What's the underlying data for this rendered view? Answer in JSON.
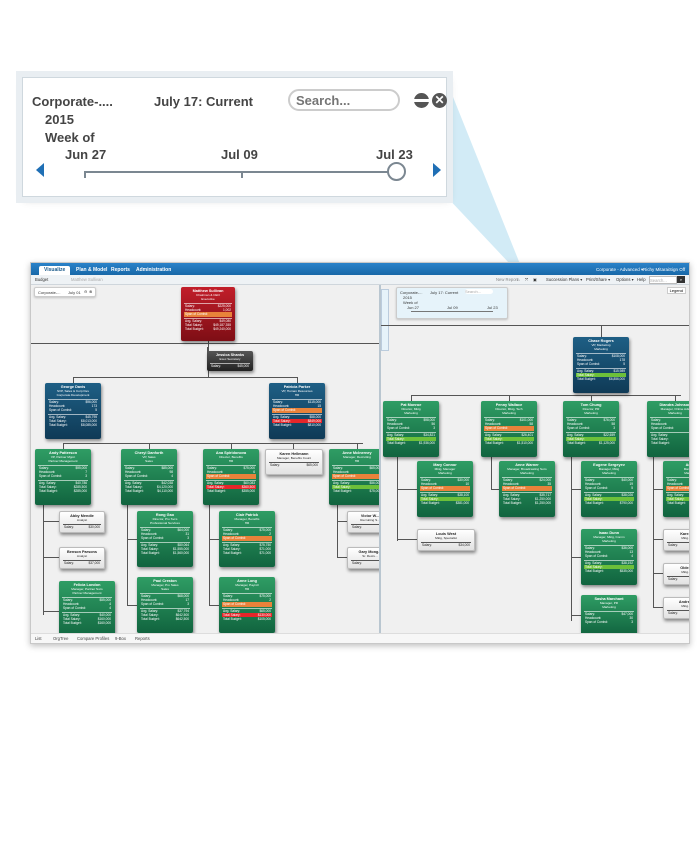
{
  "callout": {
    "title": "Corporate-....",
    "year": "2015",
    "week_of": "Week of",
    "current_label": "July 17: Current",
    "search_placeholder": "Search...",
    "timeline": {
      "ticks": [
        "Jun 27",
        "Jul 09",
        "Jul 23"
      ],
      "selected_index": 2,
      "prev_icon": "arrow-left-icon",
      "next_icon": "arrow-right-icon"
    },
    "collapse_icon": "minus-circle-icon",
    "close_icon": "close-circle-icon"
  },
  "app": {
    "tabs": [
      {
        "label": "Visualize",
        "active": true
      },
      {
        "label": "Plan & Model",
        "active": false
      },
      {
        "label": "Reports",
        "active": false
      },
      {
        "label": "Administration",
        "active": false
      }
    ],
    "top_right": {
      "org": "Corporate - Advanced ▾",
      "user": "Richy Mitarai",
      "sign_off": "Sign Off"
    },
    "subbar": {
      "budget": "Budget",
      "breadcrumb": "Matthew Sullivan",
      "new_report": "New Report",
      "menus": [
        "Succession Plans ▾",
        "Print/Share ▾",
        "Options ▾",
        "Help"
      ],
      "search_placeholder": "Search..."
    },
    "left_mini_timeline": {
      "title": "Corporate-...",
      "date": "July 01"
    },
    "right_mini_timeline": {
      "title": "Corporate-...",
      "year": "2015",
      "week_of": "Week of",
      "current": "July 17: Current",
      "search": "Search...",
      "ticks": [
        "Jun 27",
        "Jul 09",
        "Jul 23"
      ]
    },
    "legend_label": "Legend",
    "footer": [
      "List",
      "OrgTree",
      "Compare Profiles",
      "9-Box",
      "Reports"
    ],
    "colors": {
      "brand_blue": "#1f6fb5",
      "node_green": "#1d7a4d",
      "node_blue": "#173f5c",
      "node_red": "#a3141d",
      "span_orange": "#e8823a",
      "over_red": "#e5262a",
      "under_green": "#6cc03a"
    }
  },
  "left_nodes": [
    {
      "name": "Matthew Sullivan",
      "title": "Chairman & CEO",
      "dept": "Executive",
      "color": "red",
      "rows": [
        [
          "Salary:",
          "$225,000"
        ],
        [
          "Headcount:",
          "1,002"
        ],
        [
          "Span of Control:",
          "",
          "orange"
        ],
        [
          "Avg. Salary:",
          "$49,080",
          "sep"
        ],
        [
          "Total Salary:",
          "$49,187,355"
        ],
        [
          "Total Budget:",
          "$49,240,000"
        ]
      ]
    },
    {
      "name": "Jessica Shanks",
      "title": "Exec Secretary",
      "dept": "",
      "color": "dark",
      "rows": [
        [
          "Salary:",
          "$45,000"
        ]
      ]
    },
    {
      "name": "George Davis",
      "title": "SVP, Sales & Corp Dev",
      "dept": "Corporate Development",
      "color": "blue",
      "rows": [
        [
          "Salary:",
          "$96,000"
        ],
        [
          "Headcount:",
          "173"
        ],
        [
          "Span of Control:",
          "5"
        ],
        [
          "Avg. Salary:",
          "$45,795",
          "sep"
        ],
        [
          "Total Salary:",
          "$8,013,000"
        ],
        [
          "Total Budget:",
          "$8,085,000"
        ]
      ]
    },
    {
      "name": "Patricia Parker",
      "title": "VP, Human Resources",
      "dept": "HR",
      "color": "blue",
      "rows": [
        [
          "Salary:",
          "$115,000"
        ],
        [
          "Headcount:",
          "15"
        ],
        [
          "Span of Control:",
          "",
          "orange"
        ],
        [
          "Avg. Salary:",
          "$58,000",
          "sep"
        ],
        [
          "Total Salary:",
          "$849,000",
          "redhl"
        ],
        [
          "Total Budget:",
          "$810,000"
        ]
      ]
    },
    {
      "name": "Andy Patterson",
      "title": "VP, Partner Mgmt",
      "dept": "Partner Management",
      "color": "green",
      "rows": [
        [
          "Salary:",
          "$95,000"
        ],
        [
          "Headcount:",
          "7"
        ],
        [
          "Span of Control:",
          "3"
        ],
        [
          "Avg. Salary:",
          "$40,786",
          "sep"
        ],
        [
          "Total Salary:",
          "$285,500"
        ],
        [
          "Total Budget:",
          "$285,000"
        ]
      ]
    },
    {
      "name": "Cheryl Danforth",
      "title": "VP, Sales",
      "dept": "Sales",
      "color": "green",
      "rows": [
        [
          "Salary:",
          "$85,000"
        ],
        [
          "Headcount:",
          "98"
        ],
        [
          "Span of Control:",
          "4"
        ],
        [
          "Avg. Salary:",
          "$42,038",
          "sep"
        ],
        [
          "Total Salary:",
          "$4,120,000"
        ],
        [
          "Total Budget:",
          "$4,110,000"
        ]
      ]
    },
    {
      "name": "Ana Spiridonova",
      "title": "Director, Benefits",
      "dept": "HR",
      "color": "green",
      "rows": [
        [
          "Salary:",
          "$75,000"
        ],
        [
          "Headcount:",
          "6"
        ],
        [
          "Span of Control:",
          "",
          "orange"
        ],
        [
          "Avg. Salary:",
          "$60,083",
          "sep"
        ],
        [
          "Total Salary:",
          "$360,500",
          "redhl"
        ],
        [
          "Total Budget:",
          "$355,000"
        ]
      ]
    },
    {
      "name": "Karen Hellmann",
      "title": "Manager, Benefits Count",
      "dept": "",
      "color": "white",
      "rows": [
        [
          "Salary:",
          "$65,000"
        ]
      ]
    },
    {
      "name": "Anne McInerney",
      "title": "Manager, Recruiting",
      "dept": "HR",
      "color": "green",
      "rows": [
        [
          "Salary:",
          "$65,000"
        ],
        [
          "Headcount:",
          ""
        ],
        [
          "Span of Control:",
          "",
          "orange"
        ],
        [
          "Avg. Salary:",
          "$56,000",
          "sep"
        ],
        [
          "Total Salary:",
          "",
          "greenhl"
        ],
        [
          "Total Budget:",
          "$75,000"
        ]
      ]
    },
    {
      "name": "Abby Mendle",
      "title": "Analyst",
      "dept": "",
      "color": "white",
      "rows": [
        [
          "Salary:",
          "$30,000"
        ]
      ]
    },
    {
      "name": "Benson Parsons",
      "title": "Analyst",
      "dept": "",
      "color": "white",
      "rows": [
        [
          "Salary:",
          "$37,000"
        ]
      ]
    },
    {
      "name": "Felicia London",
      "title": "Manager, Partner Svcs",
      "dept": "Partner Management",
      "color": "green",
      "rows": [
        [
          "Salary:",
          "$55,000"
        ],
        [
          "Headcount:",
          "4"
        ],
        [
          "Span of Control:",
          "4"
        ],
        [
          "Avg. Salary:",
          "$40,000",
          "sep"
        ],
        [
          "Total Salary:",
          "$160,000"
        ],
        [
          "Total Budget:",
          "$160,000"
        ]
      ]
    },
    {
      "name": "Rong Gao",
      "title": "Director, Pro Svcs",
      "dept": "Professional Services",
      "color": "green",
      "rows": [
        [
          "Salary:",
          "$64,000"
        ],
        [
          "Headcount:",
          "31"
        ],
        [
          "Span of Control:",
          "3"
        ],
        [
          "Avg. Salary:",
          "$50,064",
          "sep"
        ],
        [
          "Total Salary:",
          "$1,555,000"
        ],
        [
          "Total Budget:",
          "$1,560,000"
        ]
      ]
    },
    {
      "name": "Paul Creston",
      "title": "Manager, Pro Sales",
      "dept": "Sales",
      "color": "green",
      "rows": [
        [
          "Salary:",
          "$68,000"
        ],
        [
          "Headcount:",
          "17"
        ],
        [
          "Span of Control:",
          "3"
        ],
        [
          "Avg. Salary:",
          "$37,794",
          "sep"
        ],
        [
          "Total Salary:",
          "$642,500"
        ],
        [
          "Total Budget:",
          "$642,500"
        ]
      ]
    },
    {
      "name": "Clair Patrick",
      "title": "Manager, Benefits",
      "dept": "HR",
      "color": "green",
      "rows": [
        [
          "Salary:",
          "$75,000"
        ],
        [
          "Headcount:",
          "2"
        ],
        [
          "Span of Control:",
          "",
          "orange"
        ],
        [
          "Avg. Salary:",
          "$75,750",
          "sep"
        ],
        [
          "Total Salary:",
          "$71,000"
        ],
        [
          "Total Budget:",
          "$71,000"
        ]
      ]
    },
    {
      "name": "Anne Long",
      "title": "Manager, Payroll",
      "dept": "HR",
      "color": "green",
      "rows": [
        [
          "Salary:",
          "$75,000"
        ],
        [
          "Headcount:",
          "2"
        ],
        [
          "Span of Control:",
          "",
          "orange"
        ],
        [
          "Avg. Salary:",
          "$65,000",
          "sep"
        ],
        [
          "Total Salary:",
          "$130,000",
          "redhl"
        ],
        [
          "Total Budget:",
          "$105,000"
        ]
      ]
    },
    {
      "name": "Victor W...",
      "title": "Recruiting S...",
      "dept": "",
      "color": "white",
      "rows": [
        [
          "Salary:",
          ""
        ]
      ]
    },
    {
      "name": "Gary Mong...",
      "title": "Sr. Recru...",
      "dept": "",
      "color": "white",
      "rows": [
        [
          "Salary:",
          ""
        ]
      ]
    }
  ],
  "right_nodes": [
    {
      "name": "Chase Rogers",
      "title": "VP, Marketing",
      "dept": "Marketing",
      "color": "blue",
      "rows": [
        [
          "Salary:",
          "$108,000"
        ],
        [
          "Headcount:",
          "178"
        ],
        [
          "Span of Control:",
          "5"
        ],
        [
          "Avg. Salary:",
          "$15,989",
          "sep"
        ],
        [
          "Total Salary:",
          "",
          "greenhl"
        ],
        [
          "Total Budget:",
          "$6,856,000"
        ]
      ]
    },
    {
      "name": "Pat Monroe",
      "title": "Director, Mktg",
      "dept": "Marketing",
      "color": "green",
      "rows": [
        [
          "Salary:",
          "$98,000"
        ],
        [
          "Headcount:",
          "56"
        ],
        [
          "Span of Control:",
          "3"
        ],
        [
          "Avg. Salary:",
          "$34,821",
          "sep"
        ],
        [
          "Total Salary:",
          "",
          "greenhl"
        ],
        [
          "Total Budget:",
          "$1,936,000"
        ]
      ]
    },
    {
      "name": "Penny Wallace",
      "title": "Director, Mktg, Tech",
      "dept": "Marketing",
      "color": "green",
      "rows": [
        [
          "Salary:",
          "$101,000"
        ],
        [
          "Headcount:",
          "58"
        ],
        [
          "Span of Control:",
          "",
          "orange"
        ],
        [
          "Avg. Salary:",
          "$26,401",
          "sep"
        ],
        [
          "Total Salary:",
          "",
          "greenhl"
        ],
        [
          "Total Budget:",
          "$1,510,000"
        ]
      ]
    },
    {
      "name": "Tom Chung",
      "title": "Director, PR",
      "dept": "Marketing",
      "color": "green",
      "rows": [
        [
          "Salary:",
          "$76,000"
        ],
        [
          "Headcount:",
          "58"
        ],
        [
          "Span of Control:",
          "3"
        ],
        [
          "Avg. Salary:",
          "$22,659",
          "sep"
        ],
        [
          "Total Salary:",
          "",
          "greenhl"
        ],
        [
          "Total Budget:",
          "$1,125,000"
        ]
      ]
    },
    {
      "name": "Diandra Johnson",
      "title": "Manager, Online Ads",
      "dept": "Marketing",
      "color": "green",
      "rows": [
        [
          "Salary:",
          ""
        ],
        [
          "Headcount:",
          ""
        ],
        [
          "Span of Control:",
          ""
        ],
        [
          "Avg. Salary:",
          "",
          "sep"
        ],
        [
          "Total Salary:",
          ""
        ],
        [
          "Total Budget:",
          ""
        ]
      ]
    },
    {
      "name": "Mary Connor",
      "title": "Mktg, Manager",
      "dept": "Marketing",
      "color": "green",
      "rows": [
        [
          "Salary:",
          "$30,000"
        ],
        [
          "Headcount:",
          "10"
        ],
        [
          "Span of Control:",
          "",
          "orange"
        ],
        [
          "Avg. Salary:",
          "$38,100",
          "sep"
        ],
        [
          "Total Salary:",
          "",
          "greenhl"
        ],
        [
          "Total Budget:",
          "$381,000"
        ]
      ]
    },
    {
      "name": "Anne Warner",
      "title": "Manager, Broadcasting Svcs",
      "dept": "Marketing",
      "color": "green",
      "rows": [
        [
          "Salary:",
          "$24,000"
        ],
        [
          "Headcount:",
          "35"
        ],
        [
          "Span of Control:",
          "",
          "orange"
        ],
        [
          "Avg. Salary:",
          "$35,717",
          "sep"
        ],
        [
          "Total Salary:",
          "$1,250,000"
        ],
        [
          "Total Budget:",
          "$1,250,000"
        ]
      ]
    },
    {
      "name": "Eugene Sergeyev",
      "title": "Manager, Mktg",
      "dept": "Marketing",
      "color": "green",
      "rows": [
        [
          "Salary:",
          "$40,000"
        ],
        [
          "Headcount:",
          "19"
        ],
        [
          "Span of Control:",
          "5"
        ],
        [
          "Avg. Salary:",
          "$38,026",
          "sep"
        ],
        [
          "Total Salary:",
          "",
          "greenhl"
        ],
        [
          "Total Budget:",
          "$790,000"
        ]
      ]
    },
    {
      "name": "Adri...",
      "title": "Manager...",
      "dept": "Marketing",
      "color": "green",
      "rows": [
        [
          "Salary:",
          ""
        ],
        [
          "Headcount:",
          ""
        ],
        [
          "Span of Control:",
          "",
          "orange"
        ],
        [
          "Avg. Salary:",
          "",
          "sep"
        ],
        [
          "Total Salary:",
          "",
          "greenhl"
        ],
        [
          "Total Budget:",
          ""
        ]
      ]
    },
    {
      "name": "Louis West",
      "title": "Mktg, Specialist",
      "dept": "",
      "color": "white",
      "rows": [
        [
          "Salary:",
          "$34,000"
        ]
      ]
    },
    {
      "name": "Isaac Dunn",
      "title": "Manager, Mktg, Comm",
      "dept": "Marketing",
      "color": "green",
      "rows": [
        [
          "Salary:",
          "$36,000"
        ],
        [
          "Headcount:",
          "13"
        ],
        [
          "Span of Control:",
          "4"
        ],
        [
          "Avg. Salary:",
          "$38,192",
          "sep"
        ],
        [
          "Total Salary:",
          "",
          "greenhl"
        ],
        [
          "Total Budget:",
          "$535,000"
        ]
      ]
    },
    {
      "name": "Sasha Marchant",
      "title": "Manager, PR",
      "dept": "Marketing",
      "color": "green",
      "rows": [
        [
          "Salary:",
          "$47,000"
        ],
        [
          "Headcount:",
          "30"
        ],
        [
          "Span of Control:",
          "3"
        ]
      ]
    },
    {
      "name": "Kare...",
      "title": "Mktg...",
      "dept": "",
      "color": "white",
      "rows": [
        [
          "Salary:",
          ""
        ]
      ]
    },
    {
      "name": "Olde...",
      "title": "Mktg...",
      "dept": "",
      "color": "white",
      "rows": [
        [
          "Salary:",
          ""
        ]
      ]
    },
    {
      "name": "Andre...",
      "title": "Mktg...",
      "dept": "",
      "color": "white",
      "rows": [
        [
          "Salary:",
          ""
        ]
      ]
    }
  ]
}
